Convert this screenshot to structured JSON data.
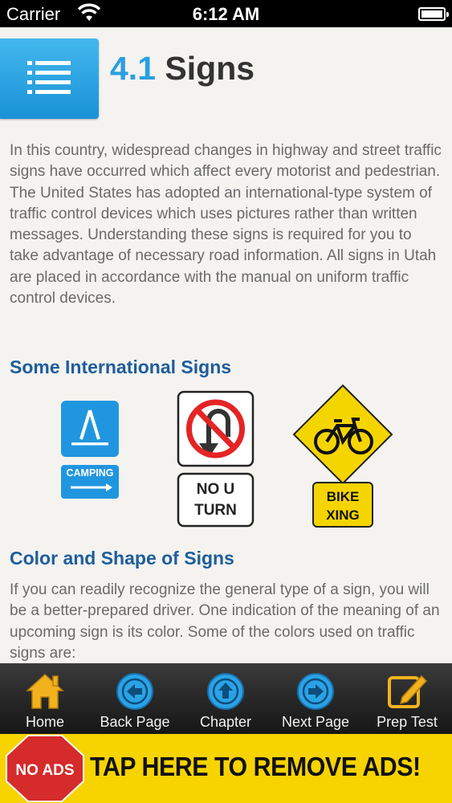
{
  "status_bar": {
    "carrier": "Carrier",
    "time": "6:12 AM"
  },
  "header": {
    "section_number": "4.1",
    "section_title": "Signs"
  },
  "intro_paragraph": "In this country, widespread changes in highway and street traffic signs have occurred which affect every motorist and pedestrian. The United States has adopted an international-type system of traffic control devices which uses pictures rather than written messages. Understanding these signs is required for you to take advantage of necessary road information. All signs in Utah are placed in accordance with the manual on uniform traffic control devices.",
  "sections": {
    "international_signs_heading": "Some International Signs",
    "color_shape_heading": "Color and Shape of Signs",
    "color_shape_paragraph": "If you can readily recognize the general type of a sign, you will be a better-prepared driver. One indication of the meaning of an upcoming sign is its color. Some of the colors used on traffic signs are:"
  },
  "signs": {
    "camping_label": "CAMPING",
    "no_u_turn_line1": "NO U",
    "no_u_turn_line2": "TURN",
    "bike_line1": "BIKE",
    "bike_line2": "XING"
  },
  "tabbar": {
    "home": "Home",
    "back": "Back Page",
    "chapter": "Chapter",
    "next": "Next Page",
    "prep": "Prep Test"
  },
  "ads": {
    "badge": "NO ADS",
    "text": "TAP HERE TO REMOVE ADS!"
  },
  "colors": {
    "accent_blue": "#2a9fe0",
    "heading_blue": "#1e5d9c",
    "ad_yellow": "#f7d300",
    "stop_red": "#d52b2b"
  }
}
